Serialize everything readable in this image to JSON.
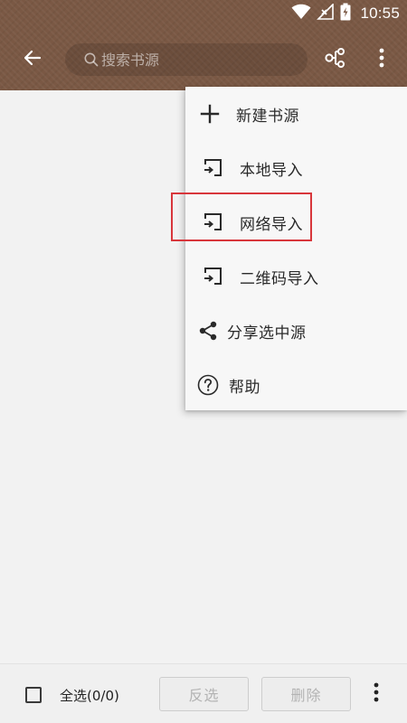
{
  "status_bar": {
    "time": "10:55",
    "icons": [
      "wifi-icon",
      "no-signal-icon",
      "battery-charging-icon"
    ]
  },
  "app_bar": {
    "back_icon": "arrow-left-icon",
    "search": {
      "placeholder": "搜索书源",
      "value": ""
    },
    "group_icon": "group-tree-icon",
    "more_icon": "more-vert-icon",
    "background_color": "#7a5844"
  },
  "menu": {
    "items": [
      {
        "label": "新建书源",
        "icon": "plus-icon"
      },
      {
        "label": "本地导入",
        "icon": "import-icon"
      },
      {
        "label": "网络导入",
        "icon": "import-icon"
      },
      {
        "label": "二维码导入",
        "icon": "import-icon"
      },
      {
        "label": "分享选中源",
        "icon": "share-icon"
      },
      {
        "label": "帮助",
        "icon": "help-icon"
      }
    ],
    "highlighted_item": "网络导入",
    "highlight_color": "#d8363b"
  },
  "bottom_bar": {
    "select_all_label": "全选(0/0)",
    "select_all_checked": false,
    "invert_label": "反选",
    "delete_label": "删除",
    "more_icon": "more-vert-icon"
  }
}
